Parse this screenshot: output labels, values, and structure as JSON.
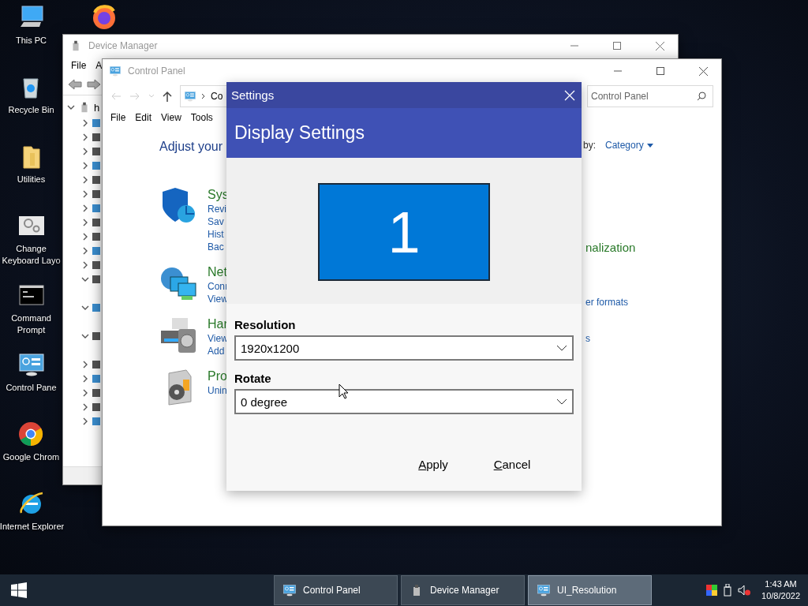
{
  "desktop_icons": [
    {
      "kind": "pc",
      "label": "This PC"
    },
    {
      "kind": "recycle",
      "label": "Recycle Bin"
    },
    {
      "kind": "folder",
      "label": "Utilities"
    },
    {
      "kind": "keyboard",
      "label": "Change Keyboard Layo"
    },
    {
      "kind": "cmd",
      "label": "Command Prompt"
    },
    {
      "kind": "control",
      "label": "Control Pane"
    },
    {
      "kind": "chrome",
      "label": "Google Chrom"
    },
    {
      "kind": "ie",
      "label": "Internet Explorer"
    }
  ],
  "desktop_icons_column_2": [
    {
      "kind": "firefox"
    }
  ],
  "device_manager": {
    "title": "Device Manager",
    "menu": [
      "File",
      "A"
    ],
    "tree": {
      "label": "h",
      "expanded": true,
      "children": [
        {
          "expanded": false
        },
        {
          "expanded": false
        },
        {
          "expanded": false
        },
        {
          "expanded": false
        },
        {
          "expanded": false
        },
        {
          "expanded": false
        },
        {
          "expanded": false
        },
        {
          "expanded": false
        },
        {
          "expanded": false
        },
        {
          "expanded": false
        },
        {
          "expanded": false
        },
        {
          "expanded": true
        },
        {
          "expanded": true
        },
        {
          "expanded": true
        },
        {
          "expanded": false
        },
        {
          "expanded": false
        },
        {
          "expanded": false
        },
        {
          "expanded": false
        },
        {
          "expanded": false
        }
      ]
    }
  },
  "control_panel": {
    "title": "Control Panel",
    "address": "Co",
    "search_placeholder": "Control Panel",
    "menu": [
      "File",
      "Edit",
      "View",
      "Tools"
    ],
    "heading": "Adjust your",
    "view_by_label": "by:",
    "view_by_value": "Category",
    "categories": [
      {
        "kind": "security",
        "title": "Sys",
        "links": [
          "Revi",
          "Sav",
          "Hist",
          "Bac"
        ]
      },
      {
        "kind": "network",
        "title": "Net",
        "links": [
          "Conı",
          "View"
        ]
      },
      {
        "kind": "hardware",
        "title": "Har",
        "links": [
          "View",
          "Add"
        ]
      },
      {
        "kind": "programs",
        "title": "Pro",
        "links": [
          "Unin"
        ]
      }
    ],
    "right_texts": [
      {
        "kind": "heading",
        "text": "nalization"
      },
      {
        "kind": "link",
        "text": "er formats"
      },
      {
        "kind": "link",
        "text": "s"
      }
    ]
  },
  "settings_dialog": {
    "title": "Settings",
    "header": "Display Settings",
    "monitor_label": "1",
    "fields": [
      {
        "label": "Resolution",
        "value": "1920x1200"
      },
      {
        "label": "Rotate",
        "value": "0 degree"
      }
    ],
    "buttons": [
      {
        "label": "Apply"
      },
      {
        "label": "Cancel"
      }
    ]
  },
  "taskbar": {
    "items": [
      {
        "kind": "control",
        "label": "Control Panel",
        "selected": false
      },
      {
        "kind": "device",
        "label": "Device Manager",
        "selected": false
      },
      {
        "kind": "control",
        "label": "UI_Resolution",
        "selected": true
      }
    ],
    "clock": {
      "time": "1:43 AM",
      "date": "10/8/2022"
    }
  }
}
